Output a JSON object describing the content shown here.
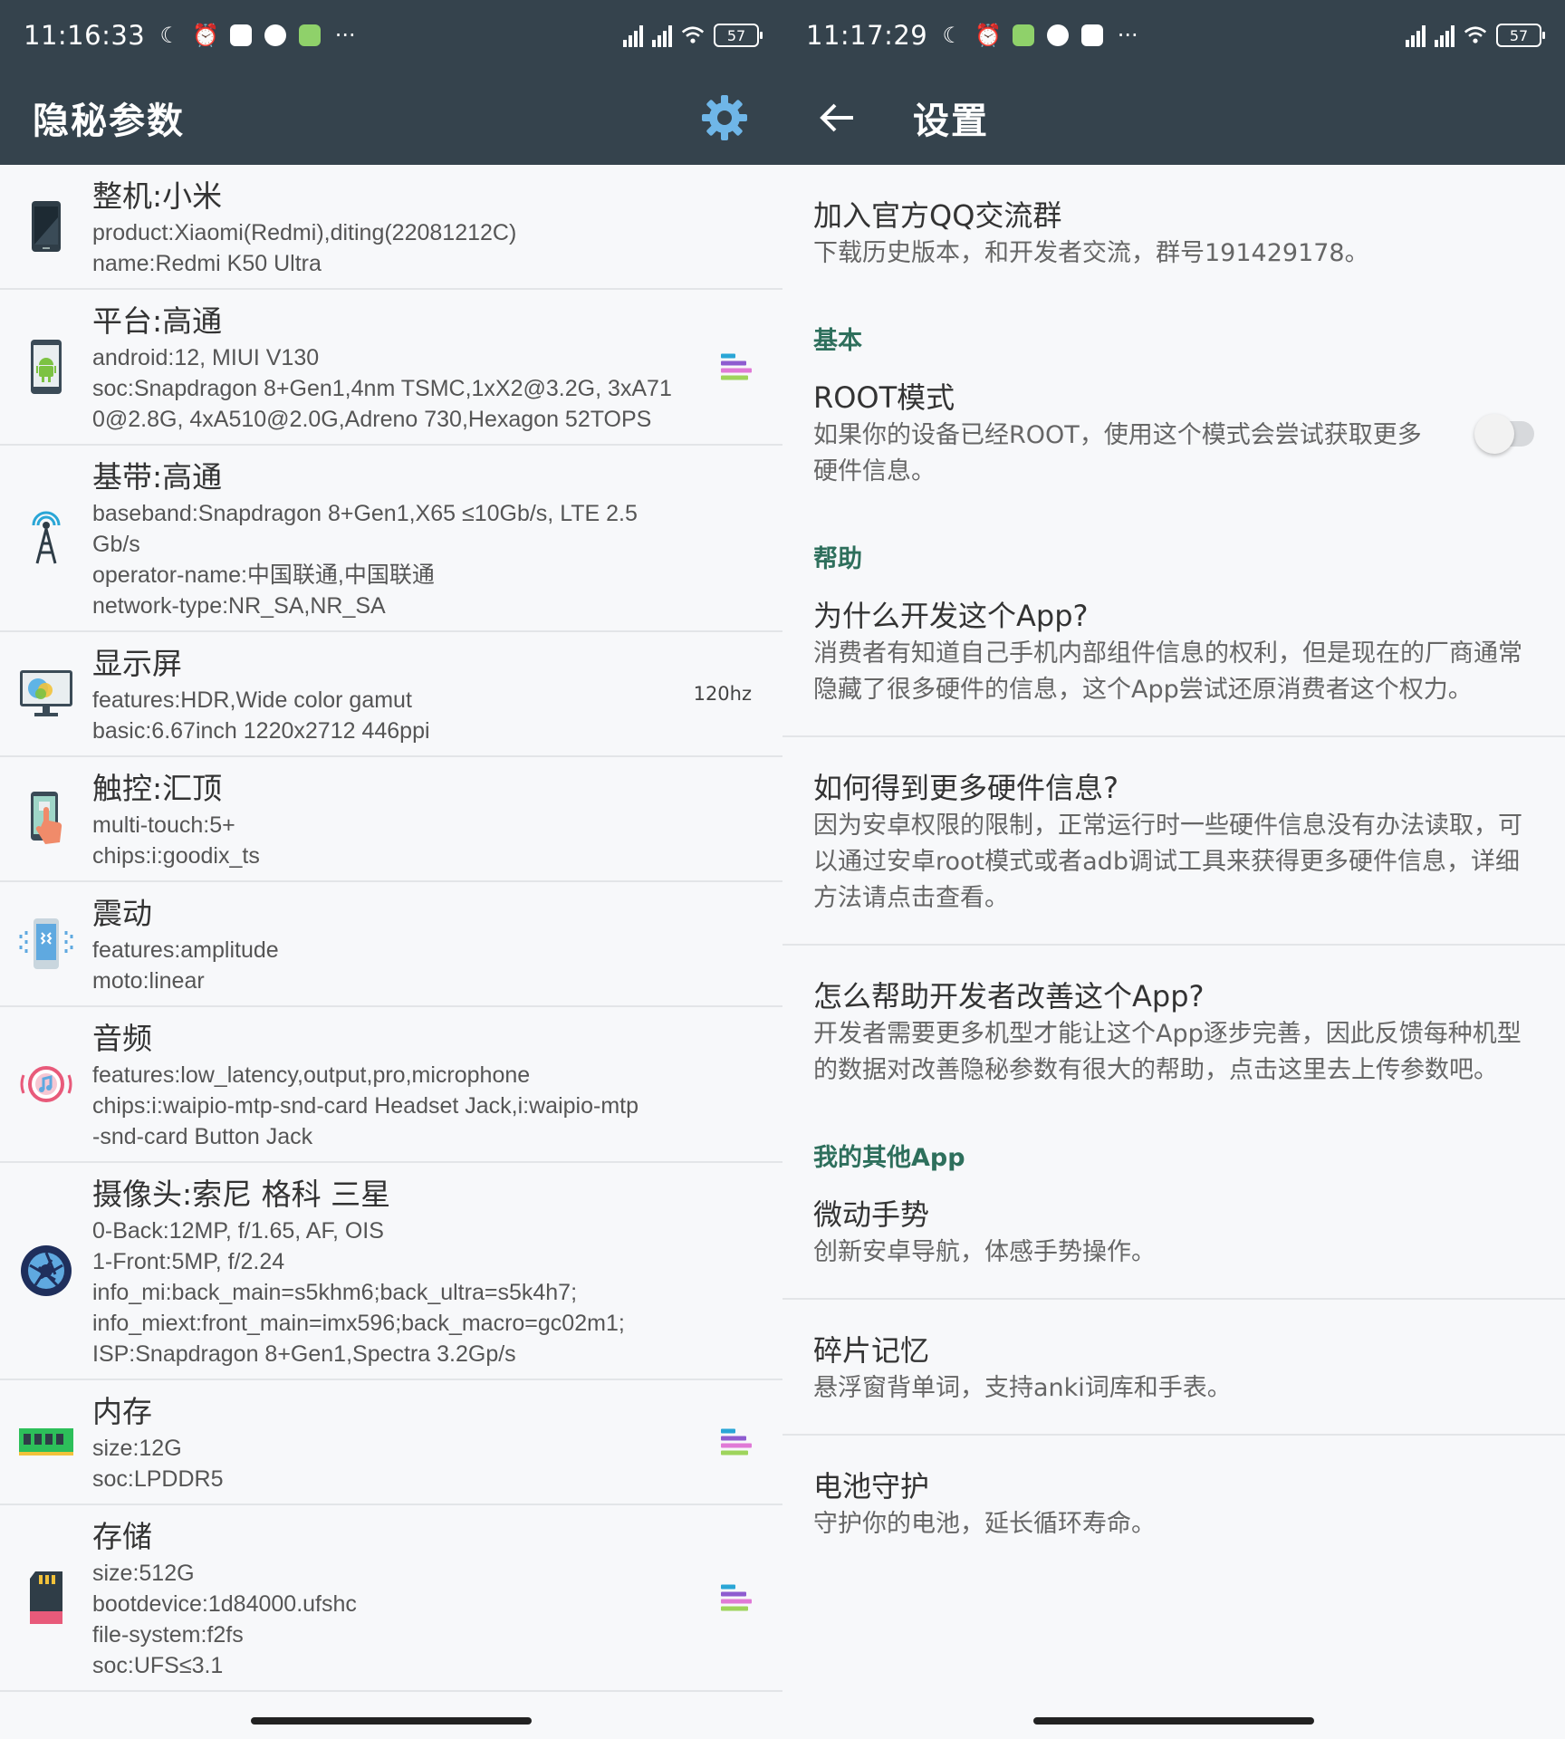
{
  "left": {
    "status": {
      "time": "11:16:33",
      "battery": "57"
    },
    "appbar": {
      "title": "隐秘参数"
    },
    "items": [
      {
        "name": "整机:小米",
        "lines": [
          "product:Xiaomi(Redmi),diting(22081212C)",
          "name:Redmi K50 Ultra"
        ],
        "right": ""
      },
      {
        "name": "平台:高通",
        "lines": [
          "android:12, MIUI V130",
          "soc:Snapdragon 8+Gen1,4nm TSMC,1xX2@3.2G, 3xA71",
          "0@2.8G, 4xA510@2.0G,Adreno 730,Hexagon 52TOPS"
        ],
        "right": ""
      },
      {
        "name": "基带:高通",
        "lines": [
          "baseband:Snapdragon 8+Gen1,X65 ≤10Gb/s, LTE 2.5",
          "Gb/s",
          "operator-name:中国联通,中国联通",
          "network-type:NR_SA,NR_SA"
        ],
        "right": ""
      },
      {
        "name": "显示屏",
        "lines": [
          "features:HDR,Wide color gamut",
          "basic:6.67inch 1220x2712 446ppi"
        ],
        "right": "120hz"
      },
      {
        "name": "触控:汇顶",
        "lines": [
          "multi-touch:5+",
          "chips:i:goodix_ts"
        ],
        "right": ""
      },
      {
        "name": "震动",
        "lines": [
          "features:amplitude",
          "moto:linear"
        ],
        "right": ""
      },
      {
        "name": "音频",
        "lines": [
          "features:low_latency,output,pro,microphone",
          "chips:i:waipio-mtp-snd-card Headset Jack,i:waipio-mtp",
          "-snd-card Button Jack"
        ],
        "right": ""
      },
      {
        "name": "摄像头:索尼 格科 三星",
        "lines": [
          "0-Back:12MP, f/1.65, AF, OIS",
          "1-Front:5MP, f/2.24",
          "info_mi:back_main=s5khm6;back_ultra=s5k4h7;",
          "info_miext:front_main=imx596;back_macro=gc02m1;",
          "ISP:Snapdragon 8+Gen1,Spectra 3.2Gp/s"
        ],
        "right": ""
      },
      {
        "name": "内存",
        "lines": [
          "size:12G",
          "soc:LPDDR5"
        ],
        "right": ""
      },
      {
        "name": "存储",
        "lines": [
          "size:512G",
          "bootdevice:1d84000.ufshc",
          "file-system:f2fs",
          "soc:UFS≤3.1"
        ],
        "right": ""
      }
    ],
    "icons": [
      "phone-icon",
      "android-icon",
      "antenna-icon",
      "monitor-icon",
      "touch-icon",
      "vibration-icon",
      "audio-icon",
      "camera-aperture-icon",
      "ram-icon",
      "sd-card-icon"
    ],
    "rank_icon": "rank-bars-icon"
  },
  "right": {
    "status": {
      "time": "11:17:29",
      "battery": "57"
    },
    "appbar": {
      "title": "设置"
    },
    "qq": {
      "title": "加入官方QQ交流群",
      "desc": "下载历史版本，和开发者交流，群号191429178。"
    },
    "basic": {
      "category": "基本",
      "root": {
        "title": "ROOT模式",
        "desc": "如果你的设备已经ROOT，使用这个模式会尝试获取更多硬件信息。"
      }
    },
    "help": {
      "category": "帮助",
      "items": [
        {
          "title": "为什么开发这个App?",
          "desc": "消费者有知道自己手机内部组件信息的权利，但是现在的厂商通常隐藏了很多硬件的信息，这个App尝试还原消费者这个权力。"
        },
        {
          "title": "如何得到更多硬件信息?",
          "desc": "因为安卓权限的限制，正常运行时一些硬件信息没有办法读取，可以通过安卓root模式或者adb调试工具来获得更多硬件信息，详细方法请点击查看。"
        },
        {
          "title": "怎么帮助开发者改善这个App?",
          "desc": "开发者需要更多机型才能让这个App逐步完善，因此反馈每种机型的数据对改善隐秘参数有很大的帮助，点击这里去上传参数吧。"
        }
      ]
    },
    "other": {
      "category": "我的其他App",
      "items": [
        {
          "title": "微动手势",
          "desc": "创新安卓导航，体感手势操作。"
        },
        {
          "title": "碎片记忆",
          "desc": "悬浮窗背单词，支持anki词库和手表。"
        },
        {
          "title": "电池守护",
          "desc": "守护你的电池，延长循环寿命。"
        }
      ]
    }
  },
  "colors": {
    "bar": "#35434d",
    "accent": "#2e6f5c",
    "background": "#f7f8fa"
  }
}
